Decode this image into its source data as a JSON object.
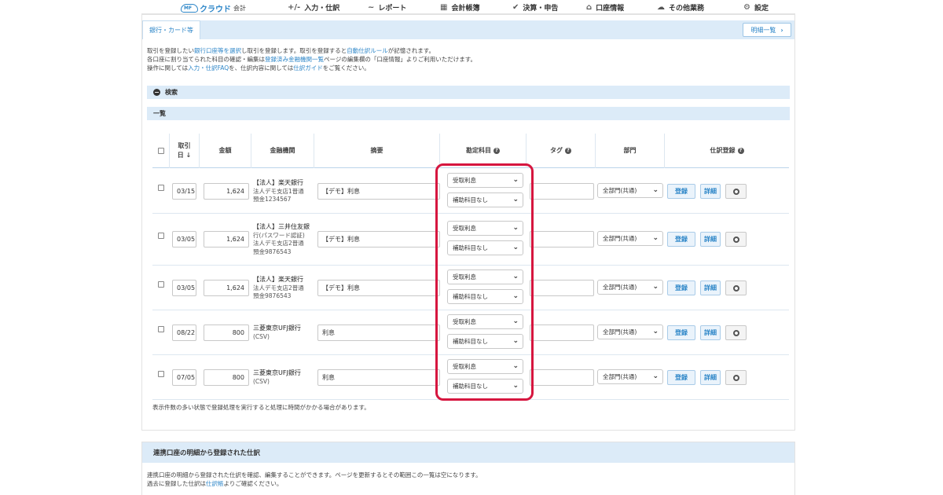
{
  "nav": {
    "logo": "クラウド",
    "logo_sub": "会計",
    "items": [
      {
        "icon": "+/-",
        "label": "入力・仕訳"
      },
      {
        "icon": "~",
        "label": "レポート"
      },
      {
        "icon": "▦",
        "label": "会計帳簿"
      },
      {
        "icon": "✔",
        "label": "決算・申告"
      },
      {
        "icon": "⌂",
        "label": "口座情報"
      },
      {
        "icon": "☁",
        "label": "その他業務"
      },
      {
        "icon": "⚙",
        "label": "設定"
      }
    ]
  },
  "tabs": {
    "active": "銀行・カード等",
    "meisai_button": "明細一覧",
    "meisai_chevron": "›"
  },
  "description": {
    "line1_a": "取引を登録したい",
    "line1_link1": "銀行口座等を選択",
    "line1_b": "し取引を登録します。取引を登録すると",
    "line1_link2": "自動仕訳ルール",
    "line1_c": "が記憶されます。",
    "line2_a": "各口座に割り当てられた科目の確認・編集は",
    "line2_link": "登録済み金融機関一覧",
    "line2_b": "ページの編集欄の「口座情報」よりご利用いただけます。",
    "line3_a": "操作に関しては",
    "line3_link1": "入力・仕訳FAQ",
    "line3_b": "を、仕訳内容に関しては",
    "line3_link2": "仕訳ガイド",
    "line3_c": "をご覧ください。"
  },
  "search_section": {
    "label": "検索",
    "icon": "−"
  },
  "list_section": {
    "label": "一覧"
  },
  "table": {
    "headers": {
      "date_line1": "取引",
      "date_line2": "日 ↓",
      "amount": "金額",
      "bank": "金融機関",
      "memo": "摘要",
      "account": "勘定科目",
      "tag": "タグ",
      "dept": "部門",
      "register": "仕訳登録",
      "help": "?"
    },
    "rows": [
      {
        "date": "03/15",
        "amount": "1,624",
        "bank1": "【法人】楽天銀行",
        "bank2": "法人デモ支店1普通",
        "bank3": "預金1234567",
        "bank4": "",
        "memo": "【デモ】利息",
        "account": "受取利息",
        "sub_account": "補助科目なし",
        "dept": "全部門(共通)"
      },
      {
        "date": "03/05",
        "amount": "1,624",
        "bank1": "【法人】三井住友銀",
        "bank2": "行(パスワード認証)",
        "bank3": "法人デモ支店2普通",
        "bank4": "預金9876543",
        "memo": "【デモ】利息",
        "account": "受取利息",
        "sub_account": "補助科目なし",
        "dept": "全部門(共通)"
      },
      {
        "date": "03/05",
        "amount": "1,624",
        "bank1": "【法人】楽天銀行",
        "bank2": "法人デモ支店2普通",
        "bank3": "預金9876543",
        "bank4": "",
        "memo": "【デモ】利息",
        "account": "受取利息",
        "sub_account": "補助科目なし",
        "dept": "全部門(共通)"
      },
      {
        "date": "08/22",
        "amount": "800",
        "bank1": "三菱東京UFJ銀行",
        "bank2": "(CSV)",
        "bank3": "",
        "bank4": "",
        "memo": "利息",
        "account": "受取利息",
        "sub_account": "補助科目なし",
        "dept": "全部門(共通)"
      },
      {
        "date": "07/05",
        "amount": "800",
        "bank1": "三菱東京UFJ銀行",
        "bank2": "(CSV)",
        "bank3": "",
        "bank4": "",
        "memo": "利息",
        "account": "受取利息",
        "sub_account": "補助科目なし",
        "dept": "全部門(共通)"
      }
    ],
    "register_label": "登録",
    "detail_label": "詳細",
    "dropdown_icon": "⌄"
  },
  "note": "表示件数の多い状態で登録処理を実行すると処理に時間がかかる場合があります。",
  "linked_section": {
    "title": "連携口座の明細から登録された仕訳",
    "line1": "連携口座の明細から登録された仕訳を確認、編集することができます。ページを更新するとその範囲この一覧は空になります。",
    "line2_a": "過去に登録した仕訳は",
    "line2_link": "仕訳帳",
    "line2_b": "よりご確認ください。"
  },
  "colors": {
    "accent": "#2d86c8",
    "highlight": "#d6163f",
    "section_bg": "#dcebf8"
  }
}
